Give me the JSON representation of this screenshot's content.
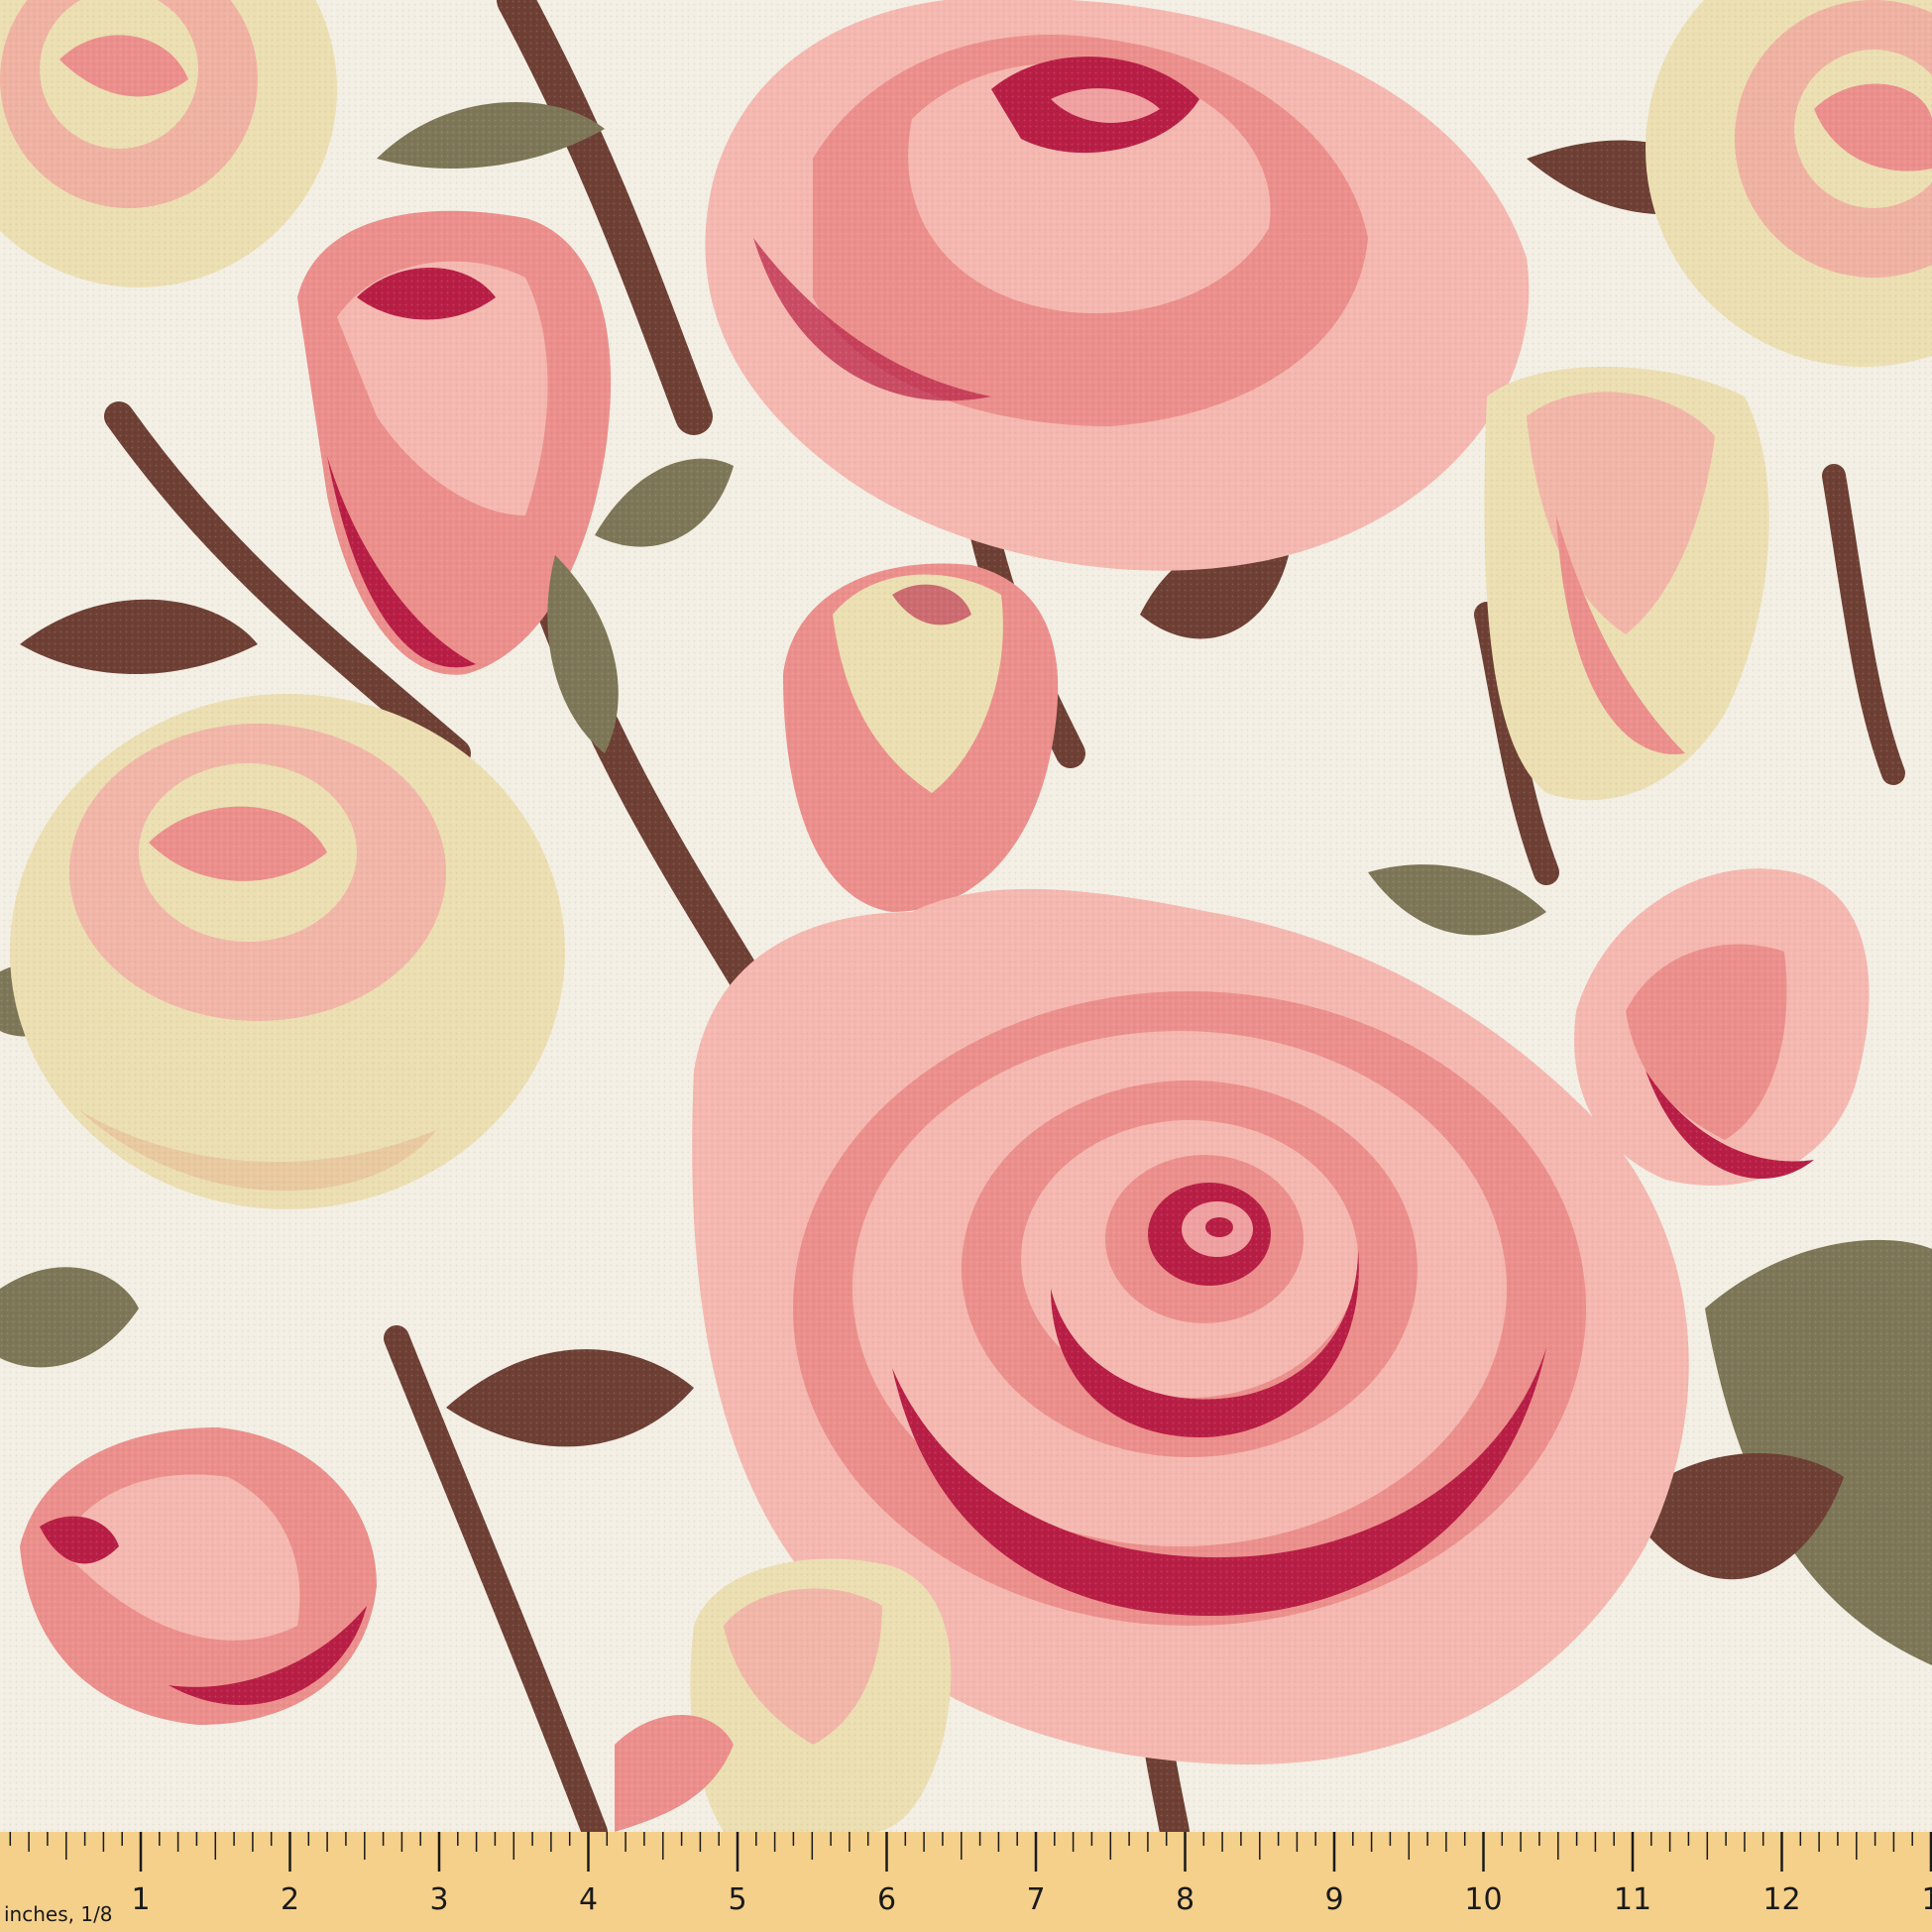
{
  "palette": {
    "background": "#f3efe4",
    "pink_light": "#f5b8b0",
    "pink_mid": "#ec8f8c",
    "crimson": "#b81e45",
    "cream": "#ecdfb2",
    "olive": "#7d7657",
    "brown": "#6e3f34",
    "ruler": "#f5d08a"
  },
  "ruler": {
    "unit_label": "inches, 1/8",
    "numbers": [
      "1",
      "2",
      "3",
      "4",
      "5",
      "6",
      "7",
      "8",
      "9",
      "10",
      "11",
      "12",
      "1"
    ]
  }
}
